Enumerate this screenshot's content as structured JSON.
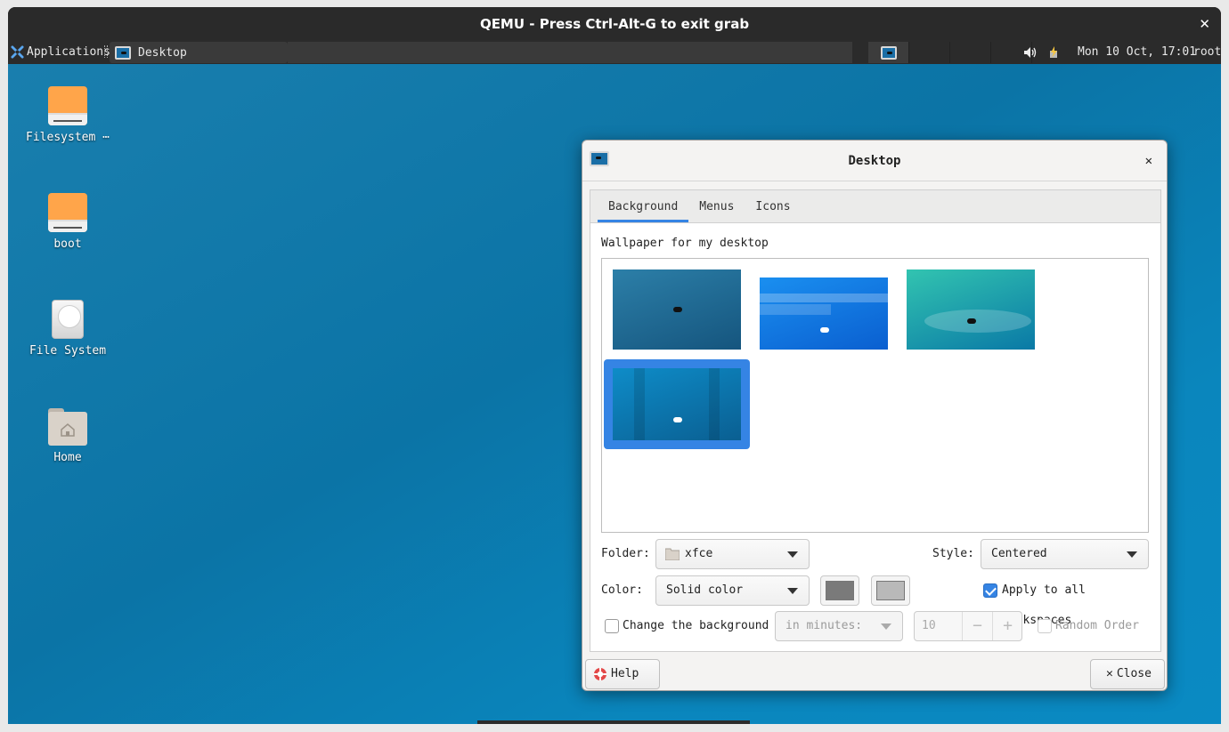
{
  "host": {
    "title": "QEMU - Press Ctrl-Alt-G to exit grab",
    "close_glyph": "✕"
  },
  "panel": {
    "applications_label": "Applications",
    "task_label": "Desktop",
    "clock": "Mon 10 Oct, 17:01",
    "user": "root",
    "workspace_count": 4,
    "active_workspace": 1
  },
  "desktop_icons": [
    {
      "label": "Filesystem ⋯",
      "icon": "drive-icon"
    },
    {
      "label": "boot",
      "icon": "drive-icon"
    },
    {
      "label": "File System",
      "icon": "harddisk-icon"
    },
    {
      "label": "Home",
      "icon": "home-folder-icon"
    }
  ],
  "dialog": {
    "title": "Desktop",
    "close_glyph": "✕",
    "tabs": [
      {
        "label": "Background",
        "active": true
      },
      {
        "label": "Menus",
        "active": false
      },
      {
        "label": "Icons",
        "active": false
      }
    ],
    "wallpaper_label": "Wallpaper for my desktop",
    "wallpapers": [
      {
        "name": "wallpaper-1",
        "colors": [
          "#2c7fa8",
          "#15557e"
        ],
        "selected": false
      },
      {
        "name": "wallpaper-2",
        "colors": [
          "#1a8ff0",
          "#0a5fd0"
        ],
        "selected": false
      },
      {
        "name": "wallpaper-3",
        "colors": [
          "#32c4b0",
          "#0a79a6"
        ],
        "selected": false
      },
      {
        "name": "wallpaper-4",
        "colors": [
          "#0e8cc8",
          "#0a5f92"
        ],
        "selected": true
      }
    ],
    "folder_label": "Folder:",
    "folder_value": "xfce",
    "style_label": "Style:",
    "style_value": "Centered",
    "color_label": "Color:",
    "color_mode": "Solid color",
    "primary_color": "#7a7a7a",
    "secondary_color": "#b9b9b9",
    "apply_all_label": "Apply to all workspaces",
    "apply_all_checked": true,
    "change_bg_label": "Change the background",
    "change_bg_checked": false,
    "interval_unit": "in minutes:",
    "interval_value": "10",
    "random_order_label": "Random Order",
    "random_order_checked": false,
    "help_label": "Help",
    "close_label": "Close"
  },
  "colors": {
    "accent": "#3584e4",
    "desktop_bg": "#0b7ab0",
    "panel_bg": "#2b2b2b"
  }
}
